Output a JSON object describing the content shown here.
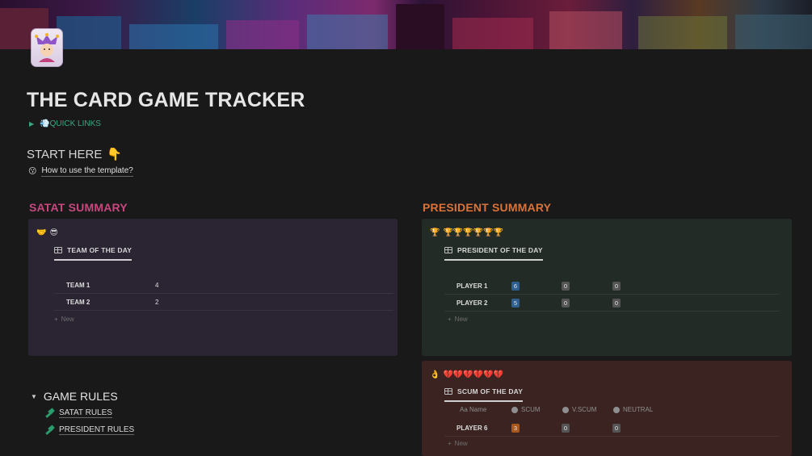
{
  "page": {
    "title": "THE CARD GAME TRACKER"
  },
  "quick_links": {
    "label": "💨QUICK LINKS"
  },
  "start_here": {
    "label": "START HERE",
    "emoji": "👇"
  },
  "how_to": {
    "emoji": "😗",
    "label": "How to use the template?"
  },
  "satat": {
    "title": "SATAT SUMMARY",
    "emojis": [
      "🤝",
      "😎"
    ],
    "view": "TEAM OF THE DAY",
    "rows": [
      {
        "name": "TEAM 1",
        "value": "4"
      },
      {
        "name": "TEAM 2",
        "value": "2"
      }
    ],
    "new_label": "New"
  },
  "president": {
    "title": "PRESIDENT SUMMARY",
    "emojis": [
      "🏆",
      "🏆🏆🏆🏆🏆🏆"
    ],
    "view": "PRESIDENT OF THE DAY",
    "rows": [
      {
        "name": "PLAYER 1",
        "v1": "6",
        "v2": "0",
        "v3": "0"
      },
      {
        "name": "PLAYER 2",
        "v1": "5",
        "v2": "0",
        "v3": "0"
      }
    ],
    "new_label": "New"
  },
  "scum": {
    "emojis": [
      "👌",
      "💔💔💔💔💔💔"
    ],
    "view": "SCUM OF THE DAY",
    "headers": {
      "name": "Aa Name",
      "scum": "SCUM",
      "vscum": "V.SCUM",
      "neutral": "NEUTRAL"
    },
    "rows": [
      {
        "name": "PLAYER 6",
        "v1": "3",
        "v2": "0",
        "v3": "0"
      }
    ],
    "new_label": "New"
  },
  "game_rules": {
    "title": "GAME RULES",
    "links": [
      {
        "label": "SATAT RULES"
      },
      {
        "label": "PRESIDENT RULES"
      }
    ]
  },
  "colors": {
    "satat_title": "#c8477f",
    "president_title": "#d9733a",
    "link_green": "#3aa882",
    "badge_blue": "#2f5f8f",
    "badge_gray": "#555555",
    "badge_orange": "#a8581c"
  }
}
